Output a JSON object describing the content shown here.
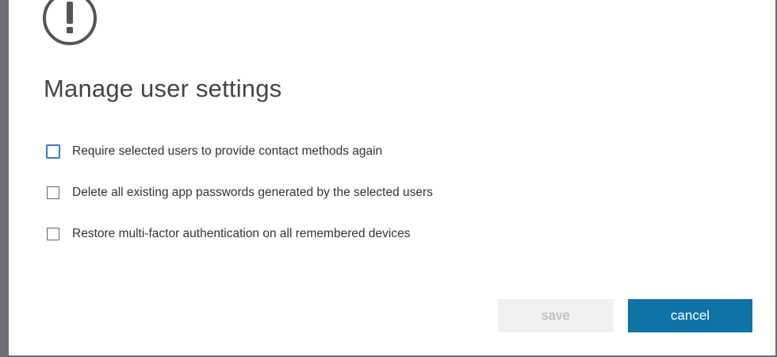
{
  "dialog": {
    "title": "Manage user settings",
    "icon": "exclamation-circle-icon",
    "options": [
      {
        "label": "Require selected users to provide contact methods again",
        "checked": false,
        "focused": true
      },
      {
        "label": "Delete all existing app passwords generated by the selected users",
        "checked": false,
        "focused": false
      },
      {
        "label": "Restore multi-factor authentication on all remembered devices",
        "checked": false,
        "focused": false
      }
    ],
    "buttons": {
      "save_label": "save",
      "save_enabled": false,
      "cancel_label": "cancel"
    }
  },
  "colors": {
    "backdrop": "#6b6f73",
    "primary_button": "#0f73a6",
    "disabled_button_bg": "#f0f0f0",
    "disabled_button_text": "#b4b4b4",
    "focus_outline": "#3c78c8",
    "title_text": "#444444"
  }
}
